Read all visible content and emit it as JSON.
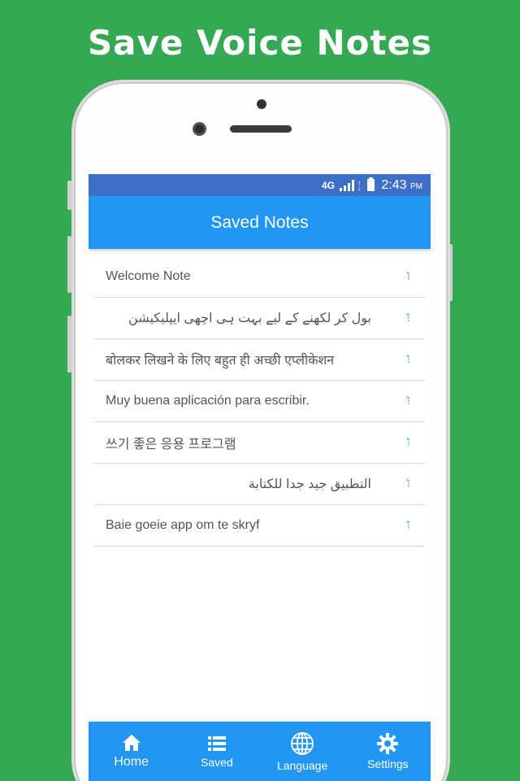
{
  "headline": "Save Voice Notes",
  "status_bar": {
    "network": "4G",
    "time": "2:43",
    "ampm": "PM"
  },
  "app_bar": {
    "title": "Saved Notes"
  },
  "notes": [
    {
      "text": "Welcome Note",
      "rtl": false
    },
    {
      "text": "بول کر لکھنے کے لیے بہت ہی اچھی ایپلیکیشن",
      "rtl": true
    },
    {
      "text": "बोलकर लिखने के लिए बहुत ही अच्छी एप्लीकेशन",
      "rtl": false
    },
    {
      "text": "Muy buena aplicación para escribir.",
      "rtl": false
    },
    {
      "text": "쓰기 좋은 응용 프로그램",
      "rtl": false
    },
    {
      "text": "التطبيق جيد جدا للكتابة",
      "rtl": true
    },
    {
      "text": "Baie goeie app om te skryf",
      "rtl": false
    }
  ],
  "note_flag_glyph": "⁝̂",
  "bottom_nav": [
    {
      "label": "Home",
      "icon": "home-icon",
      "active": true
    },
    {
      "label": "Saved",
      "icon": "list-icon",
      "active": false
    },
    {
      "label": "Language",
      "icon": "globe-icon",
      "active": false
    },
    {
      "label": "Settings",
      "icon": "gear-icon",
      "active": false
    }
  ],
  "colors": {
    "background": "#34a853",
    "status_bar": "#3e6fc6",
    "primary": "#2196f3",
    "text": "#555555"
  }
}
